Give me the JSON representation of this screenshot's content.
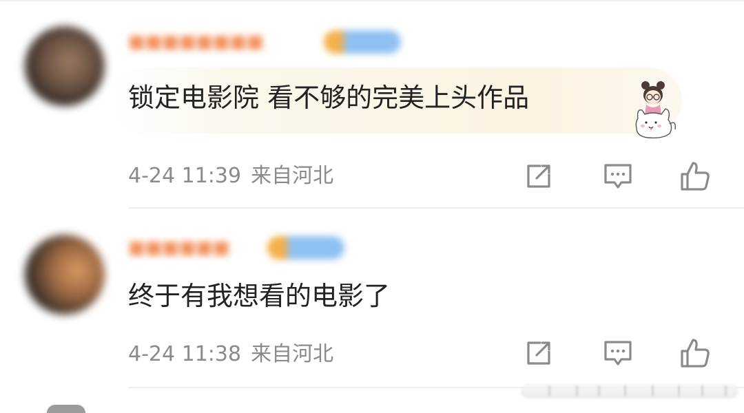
{
  "comments": [
    {
      "username": "■■■■■■■■",
      "text": "锁定电影院 看不够的完美上头作品",
      "time": "4-24 11:39",
      "location": "来自河北",
      "has_sticker": true
    },
    {
      "username": "■■■■■■",
      "text": "终于有我想看的电影了",
      "time": "4-24 11:38",
      "location": "来自河北",
      "has_sticker": false
    }
  ],
  "icons": {
    "repost": "repost-icon",
    "comment": "comment-icon",
    "like": "thumbs-up-icon"
  },
  "colors": {
    "text": "#222222",
    "meta": "#8a8a8a",
    "icon": "#8a8a8a",
    "username_blurred": "#f28f5a",
    "bubble": "#fbf4e4"
  }
}
